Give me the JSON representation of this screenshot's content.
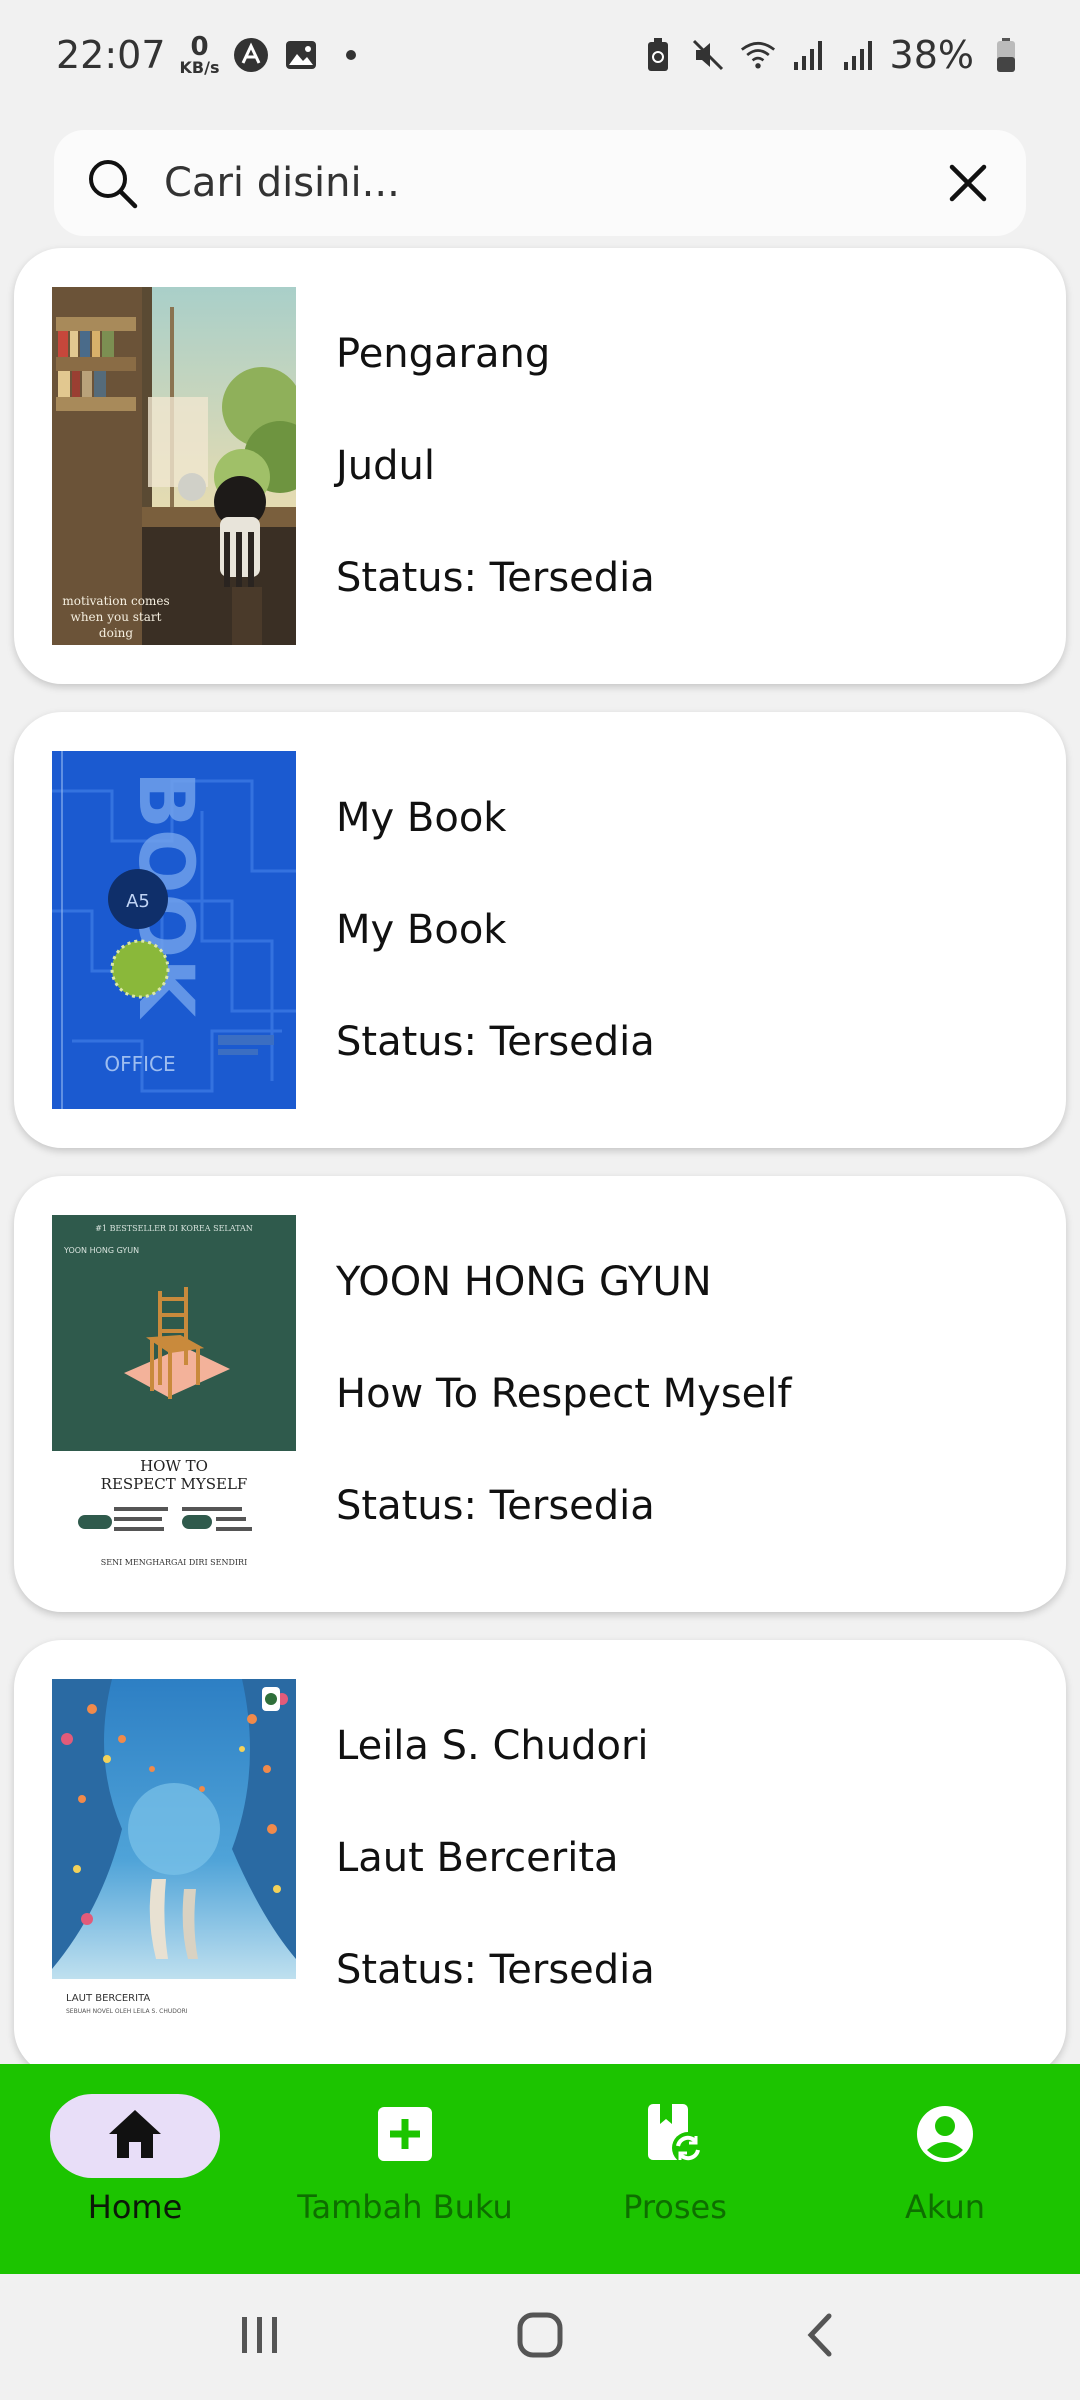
{
  "status_bar": {
    "time": "22:07",
    "net_speed_value": "0",
    "net_speed_unit": "KB/s",
    "battery": "38%"
  },
  "search": {
    "placeholder": "Cari disini..."
  },
  "books": [
    {
      "author": "Pengarang",
      "title": "Judul",
      "status": "Status: Tersedia",
      "cover_text": "motivation comes when you start doing"
    },
    {
      "author": "My Book",
      "title": "My Book",
      "status": "Status: Tersedia",
      "cover_text": "BOOK",
      "cover_sub": "OFFICE",
      "cover_code": "A5"
    },
    {
      "author": "YOON HONG GYUN",
      "title": "How To Respect Myself",
      "status": "Status: Tersedia",
      "cover_top": "#1 BESTSELLER DI KOREA SELATAN",
      "cover_author": "YOON HONG GYUN",
      "cover_title_1": "HOW TO",
      "cover_title_2": "RESPECT MYSELF",
      "cover_badge_1": "Terjual lebih dari 1 juta eksemplar di Korea Selatan",
      "cover_badge_2": "Dicetak ulang lebih dari 125 kali di Korea Selatan",
      "cover_footer": "SENI MENGHARGAI DIRI SENDIRI"
    },
    {
      "author": "Leila S. Chudori",
      "title": "Laut Bercerita",
      "status": "Status: Tersedia",
      "cover_title": "LAUT BERCERITA",
      "cover_sub": "SEBUAH NOVEL OLEH LEILA S. CHUDORI"
    }
  ],
  "nav": {
    "items": [
      {
        "label": "Home",
        "icon": "home-icon",
        "active": true
      },
      {
        "label": "Tambah Buku",
        "icon": "add-box-icon",
        "active": false
      },
      {
        "label": "Proses",
        "icon": "book-sync-icon",
        "active": false
      },
      {
        "label": "Akun",
        "icon": "account-circle-icon",
        "active": false
      }
    ]
  },
  "colors": {
    "nav_green": "#1cc400",
    "active_pill": "#e8def8",
    "card_bg": "#ffffff",
    "page_bg": "#f1f1f1"
  }
}
